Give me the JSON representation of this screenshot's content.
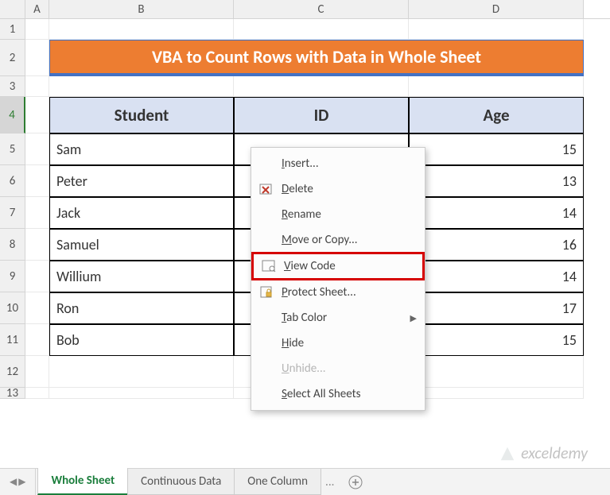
{
  "columns": {
    "A": "A",
    "B": "B",
    "C": "C",
    "D": "D"
  },
  "row_labels": [
    "1",
    "2",
    "3",
    "4",
    "5",
    "6",
    "7",
    "8",
    "9",
    "10",
    "11",
    "12",
    "13"
  ],
  "title": "VBA to Count Rows with Data in Whole Sheet",
  "table": {
    "headers": {
      "student": "Student",
      "id": "ID",
      "age": "Age"
    },
    "rows": [
      {
        "student": "Sam",
        "age": "15"
      },
      {
        "student": "Peter",
        "age": "13"
      },
      {
        "student": "Jack",
        "age": "14"
      },
      {
        "student": "Samuel",
        "age": "16"
      },
      {
        "student": "Willium",
        "age": "14"
      },
      {
        "student": "Ron",
        "age": "17"
      },
      {
        "student": "Bob",
        "age": "15"
      }
    ]
  },
  "context_menu": {
    "insert": "Insert...",
    "delete": "Delete",
    "rename": "Rename",
    "move": "Move or Copy...",
    "view_code": "View Code",
    "protect": "Protect Sheet...",
    "tab_color": "Tab Color",
    "hide": "Hide",
    "unhide": "Unhide...",
    "select_all": "Select All Sheets"
  },
  "sheet_tabs": {
    "active": "Whole Sheet",
    "t2": "Continuous Data",
    "t3": "One Column",
    "ellipsis": "..."
  },
  "watermark": "exceldemy"
}
